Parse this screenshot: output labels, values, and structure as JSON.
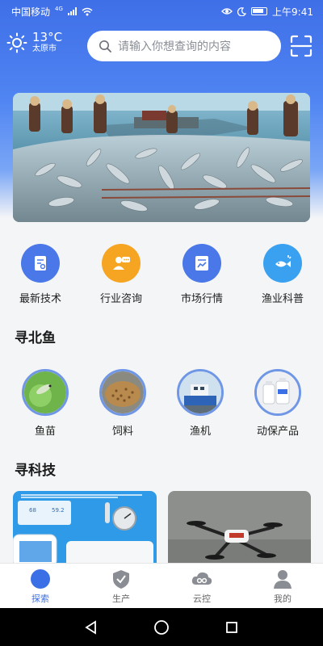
{
  "status": {
    "carrier": "中国移动",
    "network": "4G",
    "time": "上午9:41"
  },
  "weather": {
    "temperature": "13°C",
    "city": "太原市",
    "icon": "sun-icon"
  },
  "search": {
    "placeholder": "请输入你想查询的内容",
    "icon": "search-icon"
  },
  "categories": [
    {
      "label": "最新技术",
      "icon": "document-icon",
      "color": "#4a78e8"
    },
    {
      "label": "行业咨询",
      "icon": "consult-person-icon",
      "color": "#f6a523"
    },
    {
      "label": "市场行情",
      "icon": "chart-document-icon",
      "color": "#4a78e8"
    },
    {
      "label": "渔业科普",
      "icon": "fish-bulb-icon",
      "color": "#3aa0f0"
    }
  ],
  "section_fish": {
    "title": "寻北鱼"
  },
  "fish_items": [
    {
      "label": "鱼苗",
      "icon": "fry-image"
    },
    {
      "label": "饲料",
      "icon": "feed-image"
    },
    {
      "label": "渔机",
      "icon": "boat-machine-image"
    },
    {
      "label": "动保产品",
      "icon": "bottles-image"
    }
  ],
  "section_tech": {
    "title": "寻科技"
  },
  "tech_card1": {
    "reading1": "68",
    "reading2": "59.2"
  },
  "tabs": [
    {
      "label": "探索",
      "icon": "compass-icon",
      "active": true
    },
    {
      "label": "生产",
      "icon": "shield-check-icon",
      "active": false
    },
    {
      "label": "云控",
      "icon": "cloud-link-icon",
      "active": false
    },
    {
      "label": "我的",
      "icon": "user-icon",
      "active": false
    }
  ]
}
